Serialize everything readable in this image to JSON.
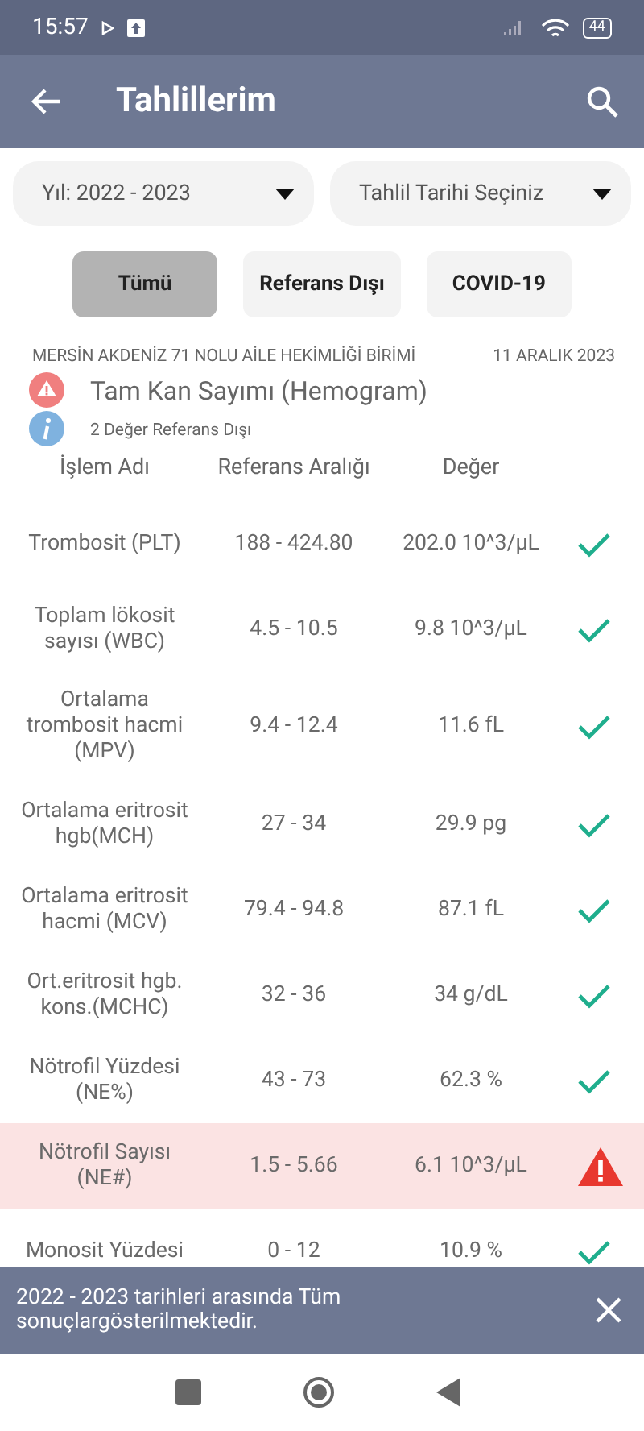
{
  "status_bar": {
    "time": "15:57",
    "battery": "44"
  },
  "app_bar": {
    "title": "Tahlillerim"
  },
  "filters": [
    {
      "label": "Yıl: 2022 - 2023"
    },
    {
      "label": "Tahlil Tarihi Seçiniz"
    }
  ],
  "tabs": [
    {
      "label": "Tümü",
      "selected": true
    },
    {
      "label": "Referans Dışı",
      "selected": false
    },
    {
      "label": "COVID-19",
      "selected": false
    }
  ],
  "report": {
    "institution": "MERSİN AKDENİZ 71 NOLU AİLE HEKİMLİĞİ BİRİMİ",
    "date": "11 ARALIK 2023",
    "test_name": "Tam Kan Sayımı (Hemogram)",
    "summary": "2 Değer Referans Dışı"
  },
  "table": {
    "columns": [
      "İşlem Adı",
      "Referans Aralığı",
      "Değer"
    ],
    "rows": [
      {
        "name": "Trombosit (PLT)",
        "range": "188 - 424.80",
        "value": "202.0 10^3/µL",
        "kind": "normal"
      },
      {
        "name": "Toplam lökosit sayısı (WBC)",
        "range": "4.5 - 10.5",
        "value": "9.8 10^3/µL",
        "kind": "normal"
      },
      {
        "name": "Ortalama trombosit hacmi (MPV)",
        "range": "9.4 - 12.4",
        "value": "11.6 fL",
        "kind": "normal"
      },
      {
        "name": "Ortalama eritrosit hgb(MCH)",
        "range": "27 - 34",
        "value": "29.9 pg",
        "kind": "normal"
      },
      {
        "name": "Ortalama eritrosit hacmi (MCV)",
        "range": "79.4 - 94.8",
        "value": "87.1 fL",
        "kind": "normal"
      },
      {
        "name": "Ort.eritrosit hgb. kons.(MCHC)",
        "range": "32 - 36",
        "value": "34 g/dL",
        "kind": "normal"
      },
      {
        "name": "Nötrofil Yüzdesi (NE%)",
        "range": "43 - 73",
        "value": "62.3 %",
        "kind": "normal"
      },
      {
        "name": "Nötrofil Sayısı (NE#)",
        "range": "1.5 - 5.66",
        "value": "6.1 10^3/µL",
        "kind": "out_of_range"
      },
      {
        "name": "Monosit Yüzdesi",
        "range": "0 - 12",
        "value": "10.9 %",
        "kind": "normal"
      }
    ]
  },
  "snackbar": {
    "message": "2022 - 2023 tarihleri arasında Tüm sonuçlargösterilmektedir."
  }
}
